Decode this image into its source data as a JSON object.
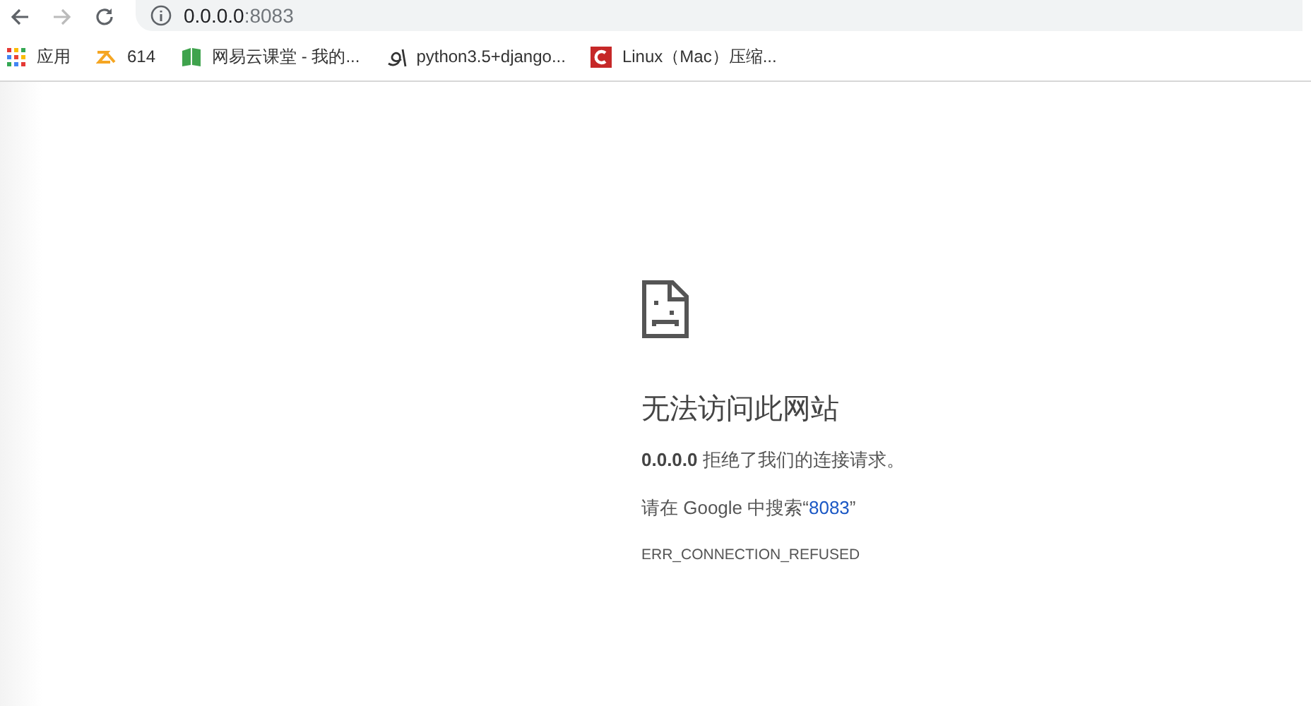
{
  "address_bar": {
    "host": "0.0.0.0",
    "port": ":8083"
  },
  "bookmarks": [
    {
      "kind": "apps",
      "label": "应用"
    },
    {
      "kind": "zigzag",
      "label": "614"
    },
    {
      "kind": "book",
      "label": "网易云课堂 - 我的..."
    },
    {
      "kind": "swirl",
      "label": "python3.5+django..."
    },
    {
      "kind": "c-logo",
      "label": "Linux（Mac）压缩..."
    }
  ],
  "error_page": {
    "title": "无法访问此网站",
    "message": "**0.0.0.0** 拒绝了我们的连接请求。",
    "suggestion_prefix": "请在 Google 中搜索“",
    "suggestion_link": "8083",
    "suggestion_suffix": "”",
    "error_code": "ERR_CONNECTION_REFUSED"
  }
}
